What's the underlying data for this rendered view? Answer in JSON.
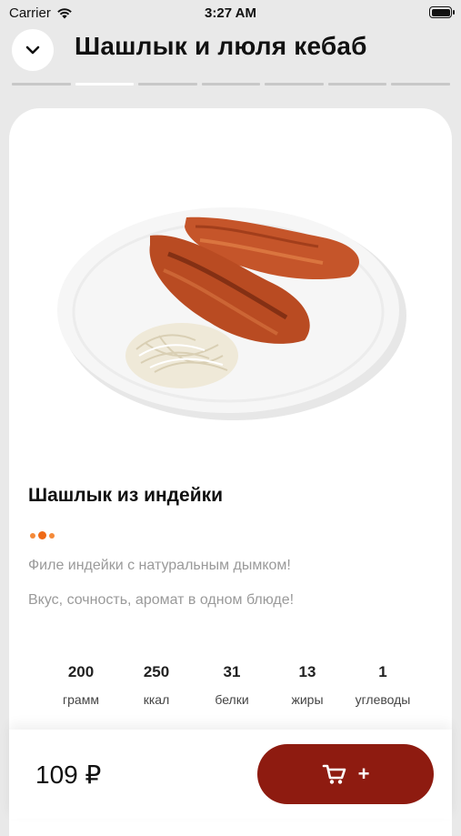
{
  "status_bar": {
    "carrier": "Carrier",
    "time": "3:27 AM"
  },
  "header": {
    "title": "Шашлык и люля кебаб",
    "back_icon": "chevron-down-icon"
  },
  "progress": {
    "segments": 7,
    "active_index": 1
  },
  "product": {
    "name": "Шашлык из индейки",
    "description_line1": "Филе индейки с натуральным дымком!",
    "description_line2": "Вкус, сочность, аромат в одном блюде!",
    "nutrition": [
      {
        "value": "200",
        "label": "грамм"
      },
      {
        "value": "250",
        "label": "ккал"
      },
      {
        "value": "31",
        "label": "белки"
      },
      {
        "value": "13",
        "label": "жиры"
      },
      {
        "value": "1",
        "label": "углеводы"
      }
    ]
  },
  "cart": {
    "price": "109 ₽",
    "add_label": "+",
    "icon": "cart-icon"
  },
  "colors": {
    "accent": "#8e1b10",
    "dots": "#ef6a17",
    "background": "#e9e9e9"
  }
}
